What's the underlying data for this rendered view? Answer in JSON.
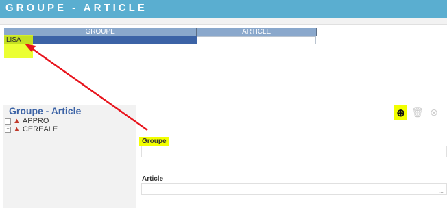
{
  "window": {
    "title": "GROUPE - ARTICLE"
  },
  "grid": {
    "columns": [
      "GROUPE",
      "ARTICLE"
    ],
    "rows": [
      {
        "groupe": "LISA",
        "article": ""
      }
    ]
  },
  "left_panel": {
    "title": "Groupe - Article",
    "tree": [
      {
        "label": "APPRO"
      },
      {
        "label": "CEREALE"
      }
    ]
  },
  "toolbar": {
    "icons": [
      "add-icon",
      "delete-icon",
      "cancel-icon",
      "validate-icon"
    ]
  },
  "form": {
    "groupe_label": "Groupe",
    "groupe_value": "",
    "article_label": "Article",
    "article_value": "",
    "browse_label": "..."
  },
  "colors": {
    "title_bar": "#5aaed0",
    "grid_header": "#8aa8cc",
    "selected_row": "#3c63a6",
    "highlight": "#f2ff00",
    "arrow": "#e8141d"
  }
}
